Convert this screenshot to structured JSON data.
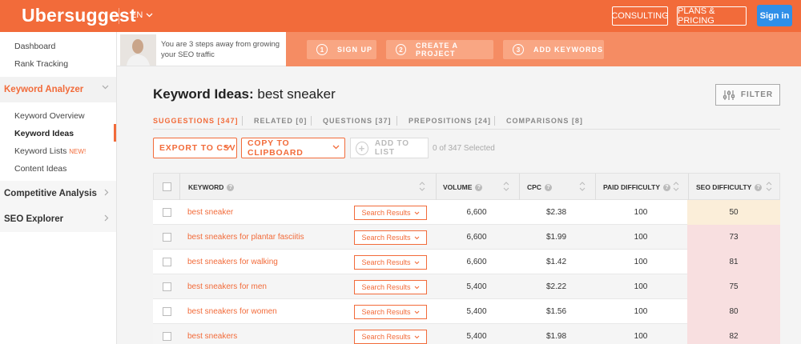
{
  "header": {
    "logo": "Ubersuggest",
    "language": "EN",
    "consulting_label": "CONSULTING",
    "plans_label": "PLANS & PRICING",
    "signin_label": "Sign in",
    "brand_color": "#f26b3a",
    "signin_color": "#2f8fe8"
  },
  "sidebar": {
    "top_links": [
      "Dashboard",
      "Rank Tracking"
    ],
    "keyword_analyzer": {
      "label": "Keyword Analyzer",
      "items": [
        "Keyword Overview",
        "Keyword Ideas",
        "Keyword Lists",
        "Content Ideas"
      ],
      "new_tag": "NEW!",
      "active_item": "Keyword Ideas"
    },
    "competitive_analysis": "Competitive Analysis",
    "seo_explorer": "SEO Explorer"
  },
  "banner": {
    "text_line1": "You are 3 steps away from growing",
    "text_line2": "your SEO traffic",
    "steps": [
      {
        "num": "1",
        "label": "SIGN UP"
      },
      {
        "num": "2",
        "label": "CREATE A PROJECT"
      },
      {
        "num": "3",
        "label": "ADD KEYWORDS"
      }
    ]
  },
  "main": {
    "title_prefix": "Keyword Ideas:",
    "title_query": "best sneaker",
    "filter_label": "FILTER",
    "tabs": [
      {
        "label": "SUGGESTIONS [347]",
        "active": true
      },
      {
        "label": "RELATED [0]",
        "active": false
      },
      {
        "label": "QUESTIONS [37]",
        "active": false
      },
      {
        "label": "PREPOSITIONS [24]",
        "active": false
      },
      {
        "label": "COMPARISONS [8]",
        "active": false
      }
    ],
    "export_label": "EXPORT TO CSV",
    "clipboard_label": "COPY TO CLIPBOARD",
    "add_label": "ADD TO LIST",
    "selected_text": "0 of 347 Selected"
  },
  "table": {
    "columns": [
      "KEYWORD",
      "VOLUME",
      "CPC",
      "PAID DIFFICULTY",
      "SEO DIFFICULTY"
    ],
    "search_results_label": "Search Results",
    "rows": [
      {
        "keyword": "best sneaker",
        "volume": "6,600",
        "cpc": "$2.38",
        "paid": "100",
        "seo": "50",
        "seo_color": "#fbeed9"
      },
      {
        "keyword": "best sneakers for plantar fasciitis",
        "volume": "6,600",
        "cpc": "$1.99",
        "paid": "100",
        "seo": "73",
        "seo_color": "#f8dfe0"
      },
      {
        "keyword": "best sneakers for walking",
        "volume": "6,600",
        "cpc": "$1.42",
        "paid": "100",
        "seo": "81",
        "seo_color": "#f8dfe0"
      },
      {
        "keyword": "best sneakers for men",
        "volume": "5,400",
        "cpc": "$2.22",
        "paid": "100",
        "seo": "75",
        "seo_color": "#f8dfe0"
      },
      {
        "keyword": "best sneakers for women",
        "volume": "5,400",
        "cpc": "$1.56",
        "paid": "100",
        "seo": "80",
        "seo_color": "#f8dfe0"
      },
      {
        "keyword": "best sneakers",
        "volume": "5,400",
        "cpc": "$1.98",
        "paid": "100",
        "seo": "82",
        "seo_color": "#f8dfe0"
      }
    ]
  }
}
